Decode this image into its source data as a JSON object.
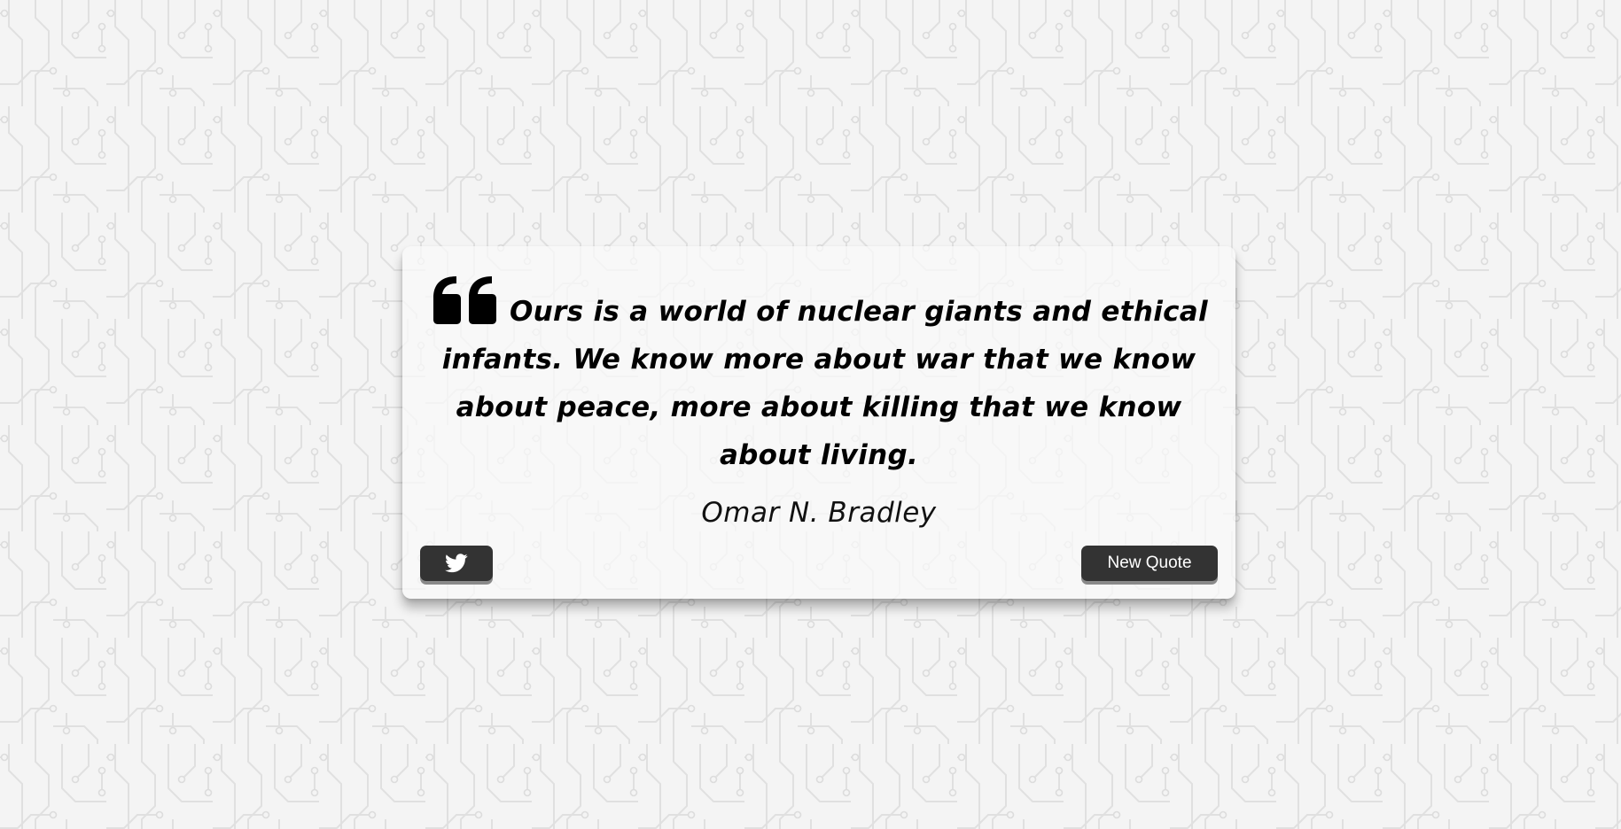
{
  "quote": {
    "text": "Ours is a world of nuclear giants and ethical infants. We know more about war that we know about peace, more about killing that we know about living.",
    "author": "Omar N. Bradley",
    "quote_icon": "quote-left-icon"
  },
  "actions": {
    "tweet_icon": "twitter-icon",
    "new_quote_label": "New Quote"
  },
  "colors": {
    "background": "#f4f4f4",
    "circuit_lines": "#e2e2e2",
    "card": "#fafafa",
    "button": "#333333",
    "button_text": "#ffffff",
    "text": "#000000"
  }
}
